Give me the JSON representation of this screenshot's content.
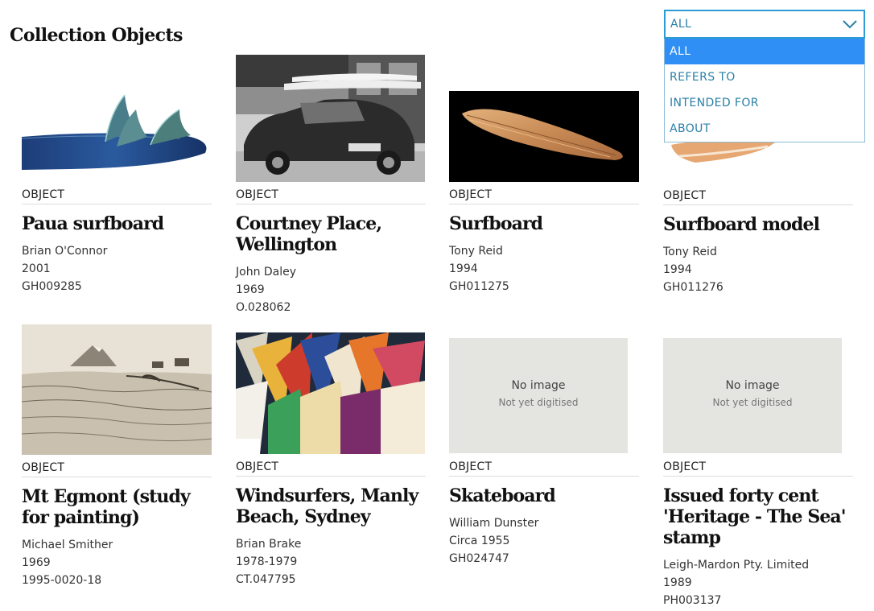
{
  "page": {
    "title": "Collection Objects"
  },
  "filter": {
    "selected": "ALL",
    "options": [
      "ALL",
      "REFERS TO",
      "INTENDED FOR",
      "ABOUT"
    ]
  },
  "objects": [
    {
      "type": "OBJECT",
      "title": "Paua surfboard",
      "maker": "Brian O'Connor",
      "date": "2001",
      "reg": "GH009285",
      "image": "surfboard-fins"
    },
    {
      "type": "OBJECT",
      "title": "Courtney Place, Wellington",
      "maker": "John Daley",
      "date": "1969",
      "reg": "O.028062",
      "image": "car-photo"
    },
    {
      "type": "OBJECT",
      "title": "Surfboard",
      "maker": "Tony Reid",
      "date": "1994",
      "reg": "GH011275",
      "image": "wooden-surfboard"
    },
    {
      "type": "OBJECT",
      "title": "Surfboard model",
      "maker": "Tony Reid",
      "date": "1994",
      "reg": "GH011276",
      "image": "surfboard-model"
    },
    {
      "type": "OBJECT",
      "title": "Mt Egmont (study for painting)",
      "maker": "Michael Smither",
      "date": "1969",
      "reg": "1995-0020-18",
      "image": "mountain-sketch"
    },
    {
      "type": "OBJECT",
      "title": "Windsurfers, Manly Beach, Sydney",
      "maker": "Brian Brake",
      "date": "1978-1979",
      "reg": "CT.047795",
      "image": "windsurfers"
    },
    {
      "type": "OBJECT",
      "title": "Skateboard",
      "maker": "William Dunster",
      "date": "Circa 1955",
      "reg": "GH024747",
      "image": "none"
    },
    {
      "type": "OBJECT",
      "title": "Issued forty cent 'Heritage - The Sea' stamp",
      "maker": "Leigh-Mardon Pty. Limited",
      "date": "1989",
      "reg": "PH003137",
      "image": "none"
    }
  ],
  "no_image": {
    "title": "No image",
    "subtitle": "Not yet digitised"
  }
}
